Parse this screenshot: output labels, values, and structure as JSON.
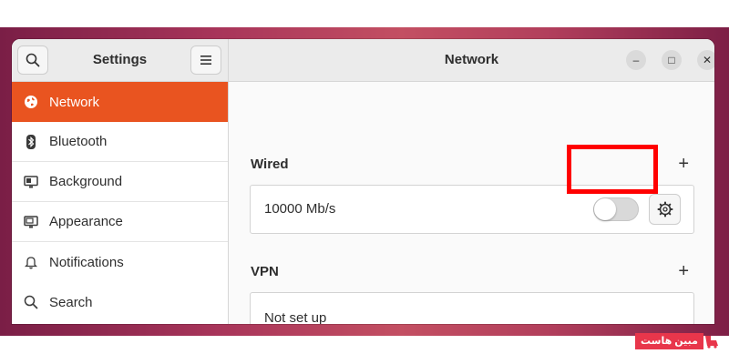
{
  "sidebar_header": {
    "title": "Settings"
  },
  "main_header": {
    "title": "Network"
  },
  "sidebar": {
    "items": [
      {
        "label": "Network",
        "icon": "globe-icon",
        "selected": true
      },
      {
        "label": "Bluetooth",
        "icon": "bluetooth-icon"
      },
      {
        "label": "Background",
        "icon": "monitor-icon"
      },
      {
        "label": "Appearance",
        "icon": "appearance-icon"
      },
      {
        "label": "Notifications",
        "icon": "bell-icon"
      },
      {
        "label": "Search",
        "icon": "search-icon"
      }
    ]
  },
  "wired": {
    "title": "Wired",
    "add_label": "+",
    "connection_label": "10000 Mb/s",
    "toggle_on": false
  },
  "vpn": {
    "title": "VPN",
    "add_label": "+",
    "status": "Not set up"
  },
  "window_controls": {
    "minimize": "–",
    "maximize": "□",
    "close": "✕"
  },
  "watermark": {
    "text": "مبین هاست"
  },
  "colors": {
    "accent": "#e95420",
    "highlight": "#ff0000",
    "watermark": "#e8364b"
  }
}
